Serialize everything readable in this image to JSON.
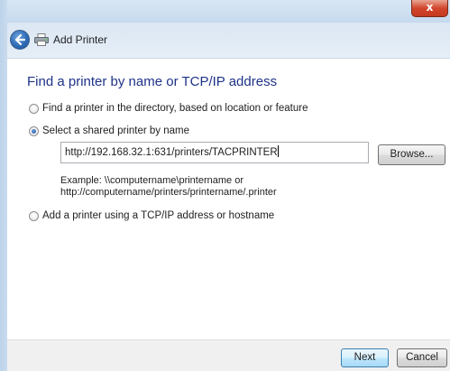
{
  "window": {
    "title": "Add Printer",
    "close_glyph": "x",
    "accent_color": "#1e3287"
  },
  "nav": {
    "back_icon": "back-arrow-icon",
    "app_icon": "printer-icon",
    "title": "Add Printer"
  },
  "page": {
    "heading": "Find a printer by name or TCP/IP address",
    "options": [
      {
        "label": "Find a printer in the directory, based on location or feature",
        "selected": false
      },
      {
        "label": "Select a shared printer by name",
        "selected": true
      },
      {
        "label": "Add a printer using a TCP/IP address or hostname",
        "selected": false
      }
    ],
    "shared_printer": {
      "value": "http://192.168.32.1:631/printers/TACPRINTER",
      "browse_label": "Browse..."
    },
    "example_line1": "Example: \\\\computername\\printername or",
    "example_line2": "http://computername/printers/printername/.printer"
  },
  "footer": {
    "next_label": "Next",
    "cancel_label": "Cancel"
  }
}
